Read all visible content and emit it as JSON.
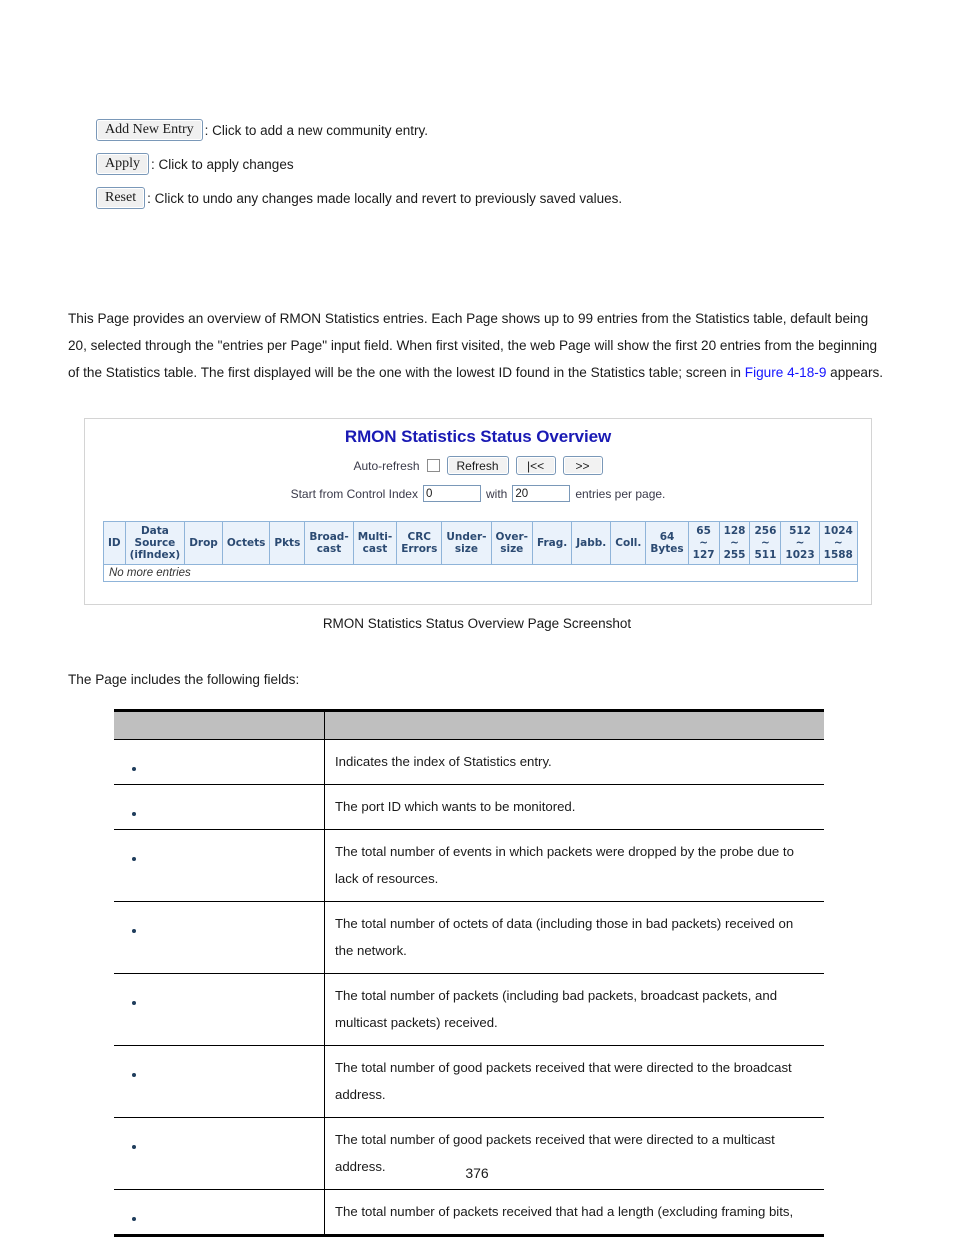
{
  "legend": {
    "items": [
      {
        "button_label": "Add New Entry",
        "description": ": Click to add a new community entry."
      },
      {
        "button_label": "Apply",
        "description": ": Click to apply changes"
      },
      {
        "button_label": "Reset",
        "description": ": Click to undo any changes made locally and revert to previously saved values."
      }
    ]
  },
  "paragraph": {
    "part1": "This Page provides an overview of RMON Statistics entries. Each Page shows up to 99 entries from the Statistics table, default being 20, selected through the \"entries per Page\" input field. When first visited, the web Page will show the first 20 entries from the beginning of the Statistics table. The first displayed will be the one with the lowest ID found in the Statistics table; screen in ",
    "link": "Figure 4-18-9",
    "part2": " appears."
  },
  "screenshot": {
    "title": "RMON Statistics Status Overview",
    "auto_refresh_label": "Auto-refresh",
    "auto_refresh_checked": false,
    "refresh_button": "Refresh",
    "first_button": "|<<",
    "next_button": ">>",
    "start_label": "Start from Control Index",
    "start_value": "0",
    "with_label": "with",
    "entries_value": "20",
    "entries_suffix": "entries per page.",
    "table_headers": [
      "ID",
      "Data\nSource\n(ifIndex)",
      "Drop",
      "Octets",
      "Pkts",
      "Broad-\ncast",
      "Multi-\ncast",
      "CRC\nErrors",
      "Under-\nsize",
      "Over-\nsize",
      "Frag.",
      "Jabb.",
      "Coll.",
      "64\nBytes",
      "65\n~\n127",
      "128\n~\n255",
      "256\n~\n511",
      "512\n~\n1023",
      "1024\n~\n1588"
    ],
    "empty_row_text": "No more entries"
  },
  "caption": "RMON Statistics Status Overview Page Screenshot",
  "fields_intro": "The Page includes the following fields:",
  "desc_table": {
    "headers": [
      "",
      ""
    ],
    "rows": [
      {
        "term": "",
        "description": "Indicates the index of Statistics entry."
      },
      {
        "term": "",
        "description": "The port ID which wants to be monitored."
      },
      {
        "term": "",
        "description": "The total number of events in which packets were dropped by the probe due to lack of resources."
      },
      {
        "term": "",
        "description": "The total number of octets of data (including those in bad packets) received on the network."
      },
      {
        "term": "",
        "description": "The total number of packets (including bad packets, broadcast packets, and multicast packets) received."
      },
      {
        "term": "",
        "description": "The total number of good packets received that were directed to the broadcast address."
      },
      {
        "term": "",
        "description": "The total number of good packets received that were directed to a multicast address."
      },
      {
        "term": "",
        "description": "The total number of packets received that had a length (excluding framing bits,"
      }
    ]
  },
  "page_number": "376",
  "colors": {
    "title_blue": "#1a1ab4",
    "link_blue": "#1414ff",
    "table_header_gray": "#bfbfbf",
    "rmon_header_blue": "#eaf2fb",
    "rmon_text_blue": "#2b4a72"
  }
}
